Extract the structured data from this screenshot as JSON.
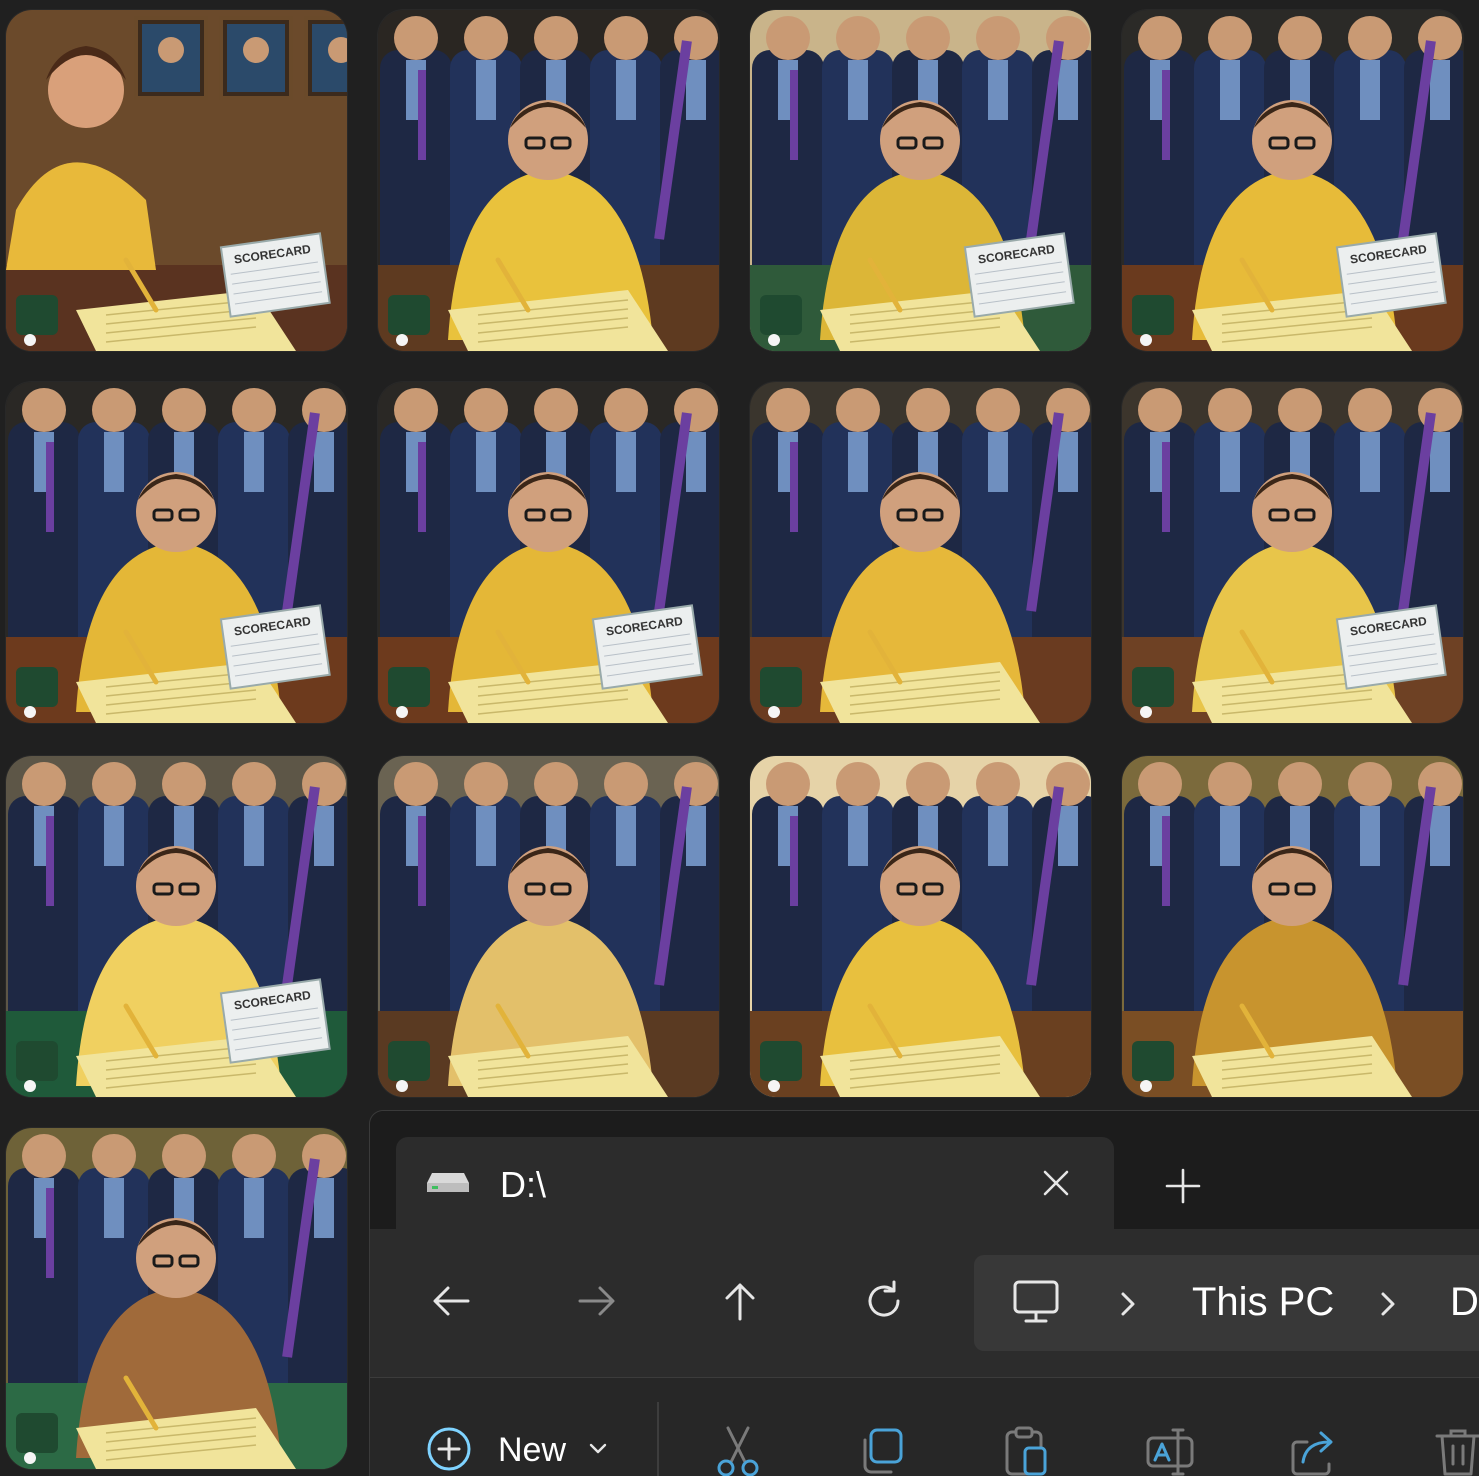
{
  "thumbnails": [
    {
      "name": "thumb-1"
    },
    {
      "name": "thumb-2"
    },
    {
      "name": "thumb-3"
    },
    {
      "name": "thumb-4"
    },
    {
      "name": "thumb-5"
    },
    {
      "name": "thumb-6"
    },
    {
      "name": "thumb-7"
    },
    {
      "name": "thumb-8"
    },
    {
      "name": "thumb-9"
    },
    {
      "name": "thumb-10"
    },
    {
      "name": "thumb-11"
    },
    {
      "name": "thumb-12"
    },
    {
      "name": "thumb-13"
    }
  ],
  "scorecard_text": "SCORECARD",
  "explorer": {
    "tab": {
      "title": "D:\\",
      "icon": "drive-icon"
    },
    "nav": {
      "back": "back-arrow-icon",
      "forward": "forward-arrow-icon",
      "up": "up-arrow-icon",
      "refresh": "refresh-icon"
    },
    "address": {
      "crumbs": [
        "This PC",
        "D"
      ]
    },
    "toolbar": {
      "new_label": "New"
    }
  },
  "colors": {
    "background": "#202020",
    "tab_active": "#2c2c2c",
    "address_bar": "#383838",
    "accent": "#60cdff",
    "shirt_yellow": "#e8c13f",
    "suit_blue": "#23345a",
    "table_wood": "#6b3b1f",
    "felt_green": "#1f5a3a"
  }
}
